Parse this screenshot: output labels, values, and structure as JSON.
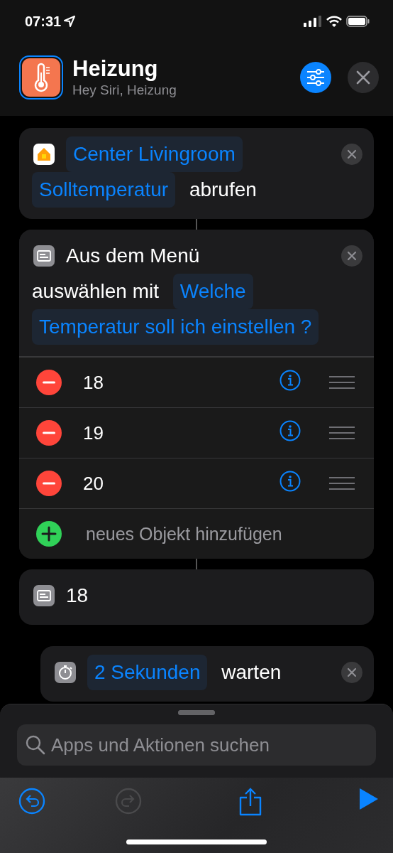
{
  "status_bar": {
    "time": "07:31"
  },
  "header": {
    "title": "Heizung",
    "subtitle": "Hey Siri, Heizung"
  },
  "actions": [
    {
      "kind": "home",
      "indented": false,
      "tokens": [
        {
          "text": "Center Livingroom",
          "variable": true
        },
        {
          "text": "Solltemperatur",
          "variable": true
        },
        {
          "text": "abrufen",
          "variable": false
        }
      ]
    },
    {
      "kind": "menu",
      "indented": false,
      "tokens": [
        {
          "text": "Aus dem Menü",
          "variable": false
        },
        {
          "text": "auswählen mit",
          "variable": false
        },
        {
          "text": "Welche",
          "variable": true
        },
        {
          "text": "Temperatur soll ich einstellen ?",
          "variable": true
        }
      ],
      "items": [
        {
          "label": "18"
        },
        {
          "label": "19"
        },
        {
          "label": "20"
        }
      ],
      "add_label": "neues Objekt hinzufügen"
    },
    {
      "kind": "menu_case",
      "indented": false,
      "tokens": [
        {
          "text": "18",
          "variable": false
        }
      ]
    },
    {
      "kind": "wait",
      "indented": true,
      "tokens": [
        {
          "text": "2 Sekunden",
          "variable": true
        },
        {
          "text": "warten",
          "variable": false
        }
      ]
    }
  ],
  "search": {
    "placeholder": "Apps und Aktionen suchen"
  },
  "toolbar": {
    "undo_disabled": false,
    "redo_disabled": true
  }
}
